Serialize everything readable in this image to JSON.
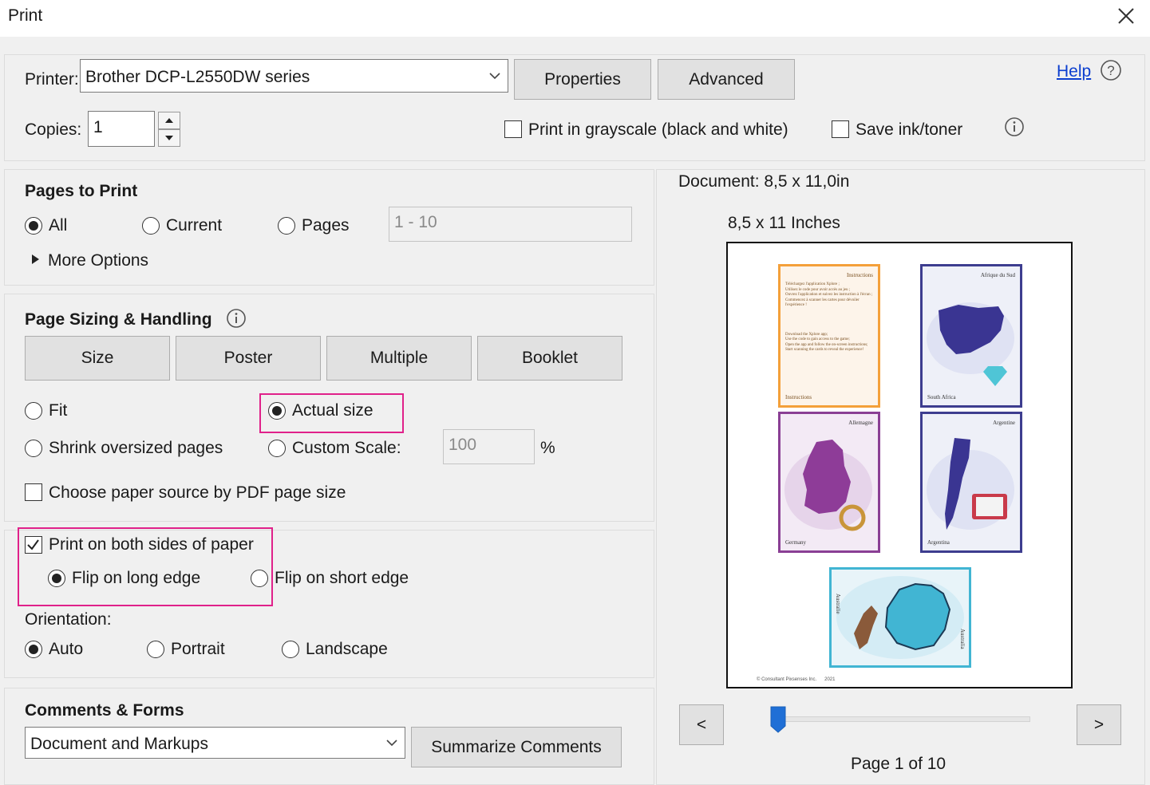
{
  "window": {
    "title": "Print"
  },
  "printer": {
    "label": "Printer:",
    "selected": "Brother DCP-L2550DW series",
    "properties_label": "Properties",
    "advanced_label": "Advanced",
    "help_label": "Help"
  },
  "copies": {
    "label": "Copies:",
    "value": "1"
  },
  "options": {
    "grayscale_label": "Print in grayscale (black and white)",
    "grayscale_checked": false,
    "save_ink_label": "Save ink/toner",
    "save_ink_checked": false
  },
  "pages_to_print": {
    "title": "Pages to Print",
    "all_label": "All",
    "current_label": "Current",
    "pages_label": "Pages",
    "pages_range": "1 - 10",
    "selected": "All",
    "more_options_label": "More Options"
  },
  "page_sizing": {
    "title": "Page Sizing & Handling",
    "tabs": [
      {
        "label": "Size"
      },
      {
        "label": "Poster"
      },
      {
        "label": "Multiple"
      },
      {
        "label": "Booklet"
      }
    ],
    "fit_label": "Fit",
    "actual_size_label": "Actual size",
    "shrink_label": "Shrink oversized pages",
    "custom_scale_label": "Custom Scale:",
    "custom_scale_value": "100",
    "percent_label": "%",
    "selected": "Actual size",
    "paper_source_label": "Choose paper source by PDF page size"
  },
  "duplex": {
    "both_sides_label": "Print on both sides of paper",
    "both_sides_checked": true,
    "long_edge_label": "Flip on long edge",
    "short_edge_label": "Flip on short edge",
    "selected": "Flip on long edge"
  },
  "orientation": {
    "label": "Orientation:",
    "auto_label": "Auto",
    "portrait_label": "Portrait",
    "landscape_label": "Landscape",
    "selected": "Auto"
  },
  "comments": {
    "title": "Comments & Forms",
    "selected": "Document and Markups",
    "summarize_label": "Summarize Comments"
  },
  "preview": {
    "document_size": "Document: 8,5 x 11,0in",
    "page_size": "8,5 x 11 Inches",
    "prev_label": "<",
    "next_label": ">",
    "page_indicator": "Page 1 of 10",
    "current_page": 1,
    "total_pages": 10,
    "footer_text": "© Consultant Pixsenses Inc.      2021",
    "cards": [
      {
        "title": "Instructions",
        "bottom": "Instructions",
        "color": "#f4a03a",
        "lines": [
          "Téléchargez l'application Xplore ;",
          "Utilisez le code pour avoir accès au jeu ;",
          "Ouvrez l'application et suivez les instruction à l'écran ;",
          "Commencez à scanner les cartes pour dévoiler l'expérience !",
          "Download the Xplore app;",
          "Use the code to gain access to the game;",
          "Open the app and follow the on-screen instructions;",
          "Start scanning the cards to reveal the experience!"
        ]
      },
      {
        "title": "Afrique du Sud",
        "bottom": "South Africa",
        "color": "#3d3d8f"
      },
      {
        "title": "Allemagne",
        "bottom": "Germany",
        "color": "#8a3f94"
      },
      {
        "title": "Argentine",
        "bottom": "Argentina",
        "color": "#3d3d8f"
      },
      {
        "title": "Australie",
        "bottom": "Australia",
        "color": "#41b5d3"
      }
    ]
  },
  "colors": {
    "highlight": "#e0218a",
    "link": "#0b3ecf",
    "slider_thumb": "#1f6fd6"
  }
}
